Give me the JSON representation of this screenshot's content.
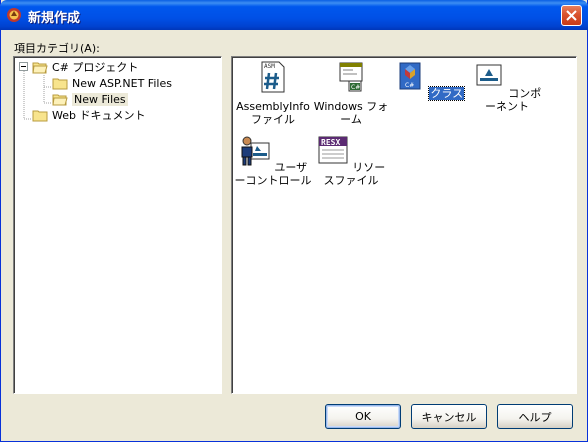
{
  "window": {
    "title": "新規作成",
    "close_label": ""
  },
  "category": {
    "label": "項目カテゴリ(A):",
    "tree": [
      {
        "label": "C# プロジェクト",
        "level": 0,
        "expanded": true
      },
      {
        "label": "New ASP.NET Files",
        "level": 1
      },
      {
        "label": "New Files",
        "level": 1,
        "selected": true
      },
      {
        "label": "Web ドキュメント",
        "level": 0
      }
    ]
  },
  "templates": [
    {
      "label": "AssemblyInfo ファイル",
      "icon": "asm-icon"
    },
    {
      "label": "Windows フォーム",
      "icon": "windows-form-icon"
    },
    {
      "label": "クラス",
      "icon": "class-icon",
      "selected": true
    },
    {
      "label": "コンポーネント",
      "icon": "component-icon"
    },
    {
      "label": "ユーザーコントロール",
      "icon": "user-control-icon"
    },
    {
      "label": "リソースファイル",
      "icon": "resx-icon"
    }
  ],
  "buttons": {
    "ok": "OK",
    "cancel": "キャンセル",
    "help": "ヘルプ"
  },
  "colors": {
    "titlebar": "#0054e3",
    "selection": "#316ac5",
    "dialog": "#ece9d8"
  }
}
